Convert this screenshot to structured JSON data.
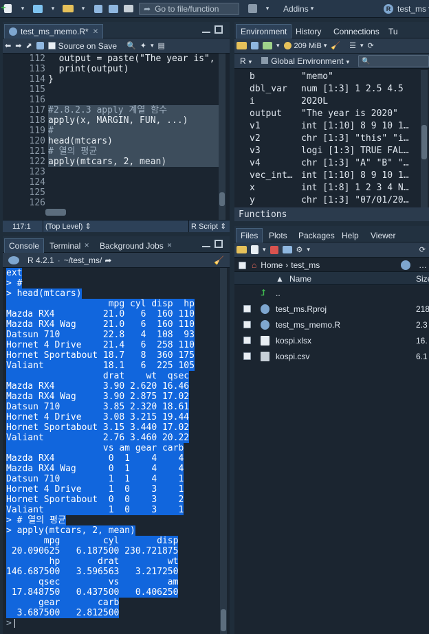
{
  "topbar": {
    "goto_placeholder": "Go to file/function",
    "addins": "Addins",
    "project": "test_ms"
  },
  "editor": {
    "tab": "test_ms_memo.R*",
    "source_on_save": "Source on Save",
    "lines": [
      {
        "n": "112",
        "t": "  output = paste(\"The year is\",",
        "sel": false
      },
      {
        "n": "113",
        "t": "  print(output)",
        "sel": false
      },
      {
        "n": "114",
        "t": "}",
        "sel": false
      },
      {
        "n": "115",
        "t": "",
        "sel": false
      },
      {
        "n": "116",
        "t": "",
        "sel": false
      },
      {
        "n": "117",
        "t": "#2.8.2.3 apply 계열 함수",
        "sel": true
      },
      {
        "n": "118",
        "t": "apply(x, MARGIN, FUN, ...)",
        "sel": true
      },
      {
        "n": "119",
        "t": "#",
        "sel": true
      },
      {
        "n": "120",
        "t": "head(mtcars)",
        "sel": true
      },
      {
        "n": "121",
        "t": "# 열의 평균",
        "sel": true
      },
      {
        "n": "122",
        "t": "apply(mtcars, 2, mean)",
        "sel": true
      },
      {
        "n": "123",
        "t": "",
        "sel": false
      },
      {
        "n": "124",
        "t": "",
        "sel": false
      },
      {
        "n": "125",
        "t": "",
        "sel": false
      },
      {
        "n": "126",
        "t": "",
        "sel": false
      }
    ],
    "status_pos": "117:1",
    "status_scope": "(Top Level)",
    "status_type": "R Script"
  },
  "console": {
    "tabs": [
      "Console",
      "Terminal",
      "Background Jobs"
    ],
    "r_version": "R 4.2.1",
    "path": "~/test_ms/",
    "lines": [
      "ext",
      "> #",
      "> head(mtcars)",
      "                   mpg cyl disp  hp",
      "Mazda RX4         21.0   6  160 110",
      "Mazda RX4 Wag     21.0   6  160 110",
      "Datsun 710        22.8   4  108  93",
      "Hornet 4 Drive    21.4   6  258 110",
      "Hornet Sportabout 18.7   8  360 175",
      "Valiant           18.1   6  225 105",
      "                  drat    wt  qsec",
      "Mazda RX4         3.90 2.620 16.46",
      "Mazda RX4 Wag     3.90 2.875 17.02",
      "Datsun 710        3.85 2.320 18.61",
      "Hornet 4 Drive    3.08 3.215 19.44",
      "Hornet Sportabout 3.15 3.440 17.02",
      "Valiant           2.76 3.460 20.22",
      "                  vs am gear carb",
      "Mazda RX4          0  1    4    4",
      "Mazda RX4 Wag      0  1    4    4",
      "Datsun 710         1  1    4    1",
      "Hornet 4 Drive     1  0    3    1",
      "Hornet Sportabout  0  0    3    2",
      "Valiant            1  0    3    1",
      "> # 열의 평균",
      "> apply(mtcars, 2, mean)",
      "       mpg        cyl       disp",
      " 20.090625   6.187500 230.721875",
      "        hp       drat         wt",
      "146.687500   3.596563   3.217250",
      "      qsec         vs         am",
      " 17.848750   0.437500   0.406250",
      "      gear       carb",
      "  3.687500   2.812500"
    ],
    "prompt": ">"
  },
  "env": {
    "tabs": [
      "Environment",
      "History",
      "Connections",
      "Tu"
    ],
    "memory": "209 MiB",
    "lang": "R",
    "scope": "Global Environment",
    "rows": [
      {
        "name": "b",
        "value": "\"memo\""
      },
      {
        "name": "dbl_var",
        "value": "num [1:3] 1 2.5 4.5"
      },
      {
        "name": "i",
        "value": "2020L"
      },
      {
        "name": "output",
        "value": "\"The year is 2020\""
      },
      {
        "name": "v1",
        "value": "int [1:10] 8 9 10 1…"
      },
      {
        "name": "v2",
        "value": "chr [1:3] \"this\" \"i…"
      },
      {
        "name": "v3",
        "value": "logi [1:3] TRUE FAL…"
      },
      {
        "name": "v4",
        "value": "chr [1:3] \"A\" \"B\" \"…"
      },
      {
        "name": "vec_int…",
        "value": "int [1:10] 8 9 10 1…"
      },
      {
        "name": "x",
        "value": "int [1:8] 1 2 3 4 N…"
      },
      {
        "name": "y",
        "value": "chr [1:3] \"07/01/20…"
      }
    ],
    "section": "Functions"
  },
  "files": {
    "tabs": [
      "Files",
      "Plots",
      "Packages",
      "Help",
      "Viewer"
    ],
    "breadcrumb_home": "Home",
    "breadcrumb_dir": "test_ms",
    "col_name": "Name",
    "col_size": "Size",
    "up": "..",
    "items": [
      {
        "name": "test_ms.Rproj",
        "size": "218",
        "icon": "rproj-icon"
      },
      {
        "name": "test_ms_memo.R",
        "size": "2.3",
        "icon": "r-file-icon"
      },
      {
        "name": "kospi.xlsx",
        "size": "16.",
        "icon": "excel-file-icon"
      },
      {
        "name": "kospi.csv",
        "size": "6.1",
        "icon": "csv-file-icon"
      }
    ]
  },
  "colors": {
    "accent": "#1166dd",
    "bg": "#1b2530"
  }
}
